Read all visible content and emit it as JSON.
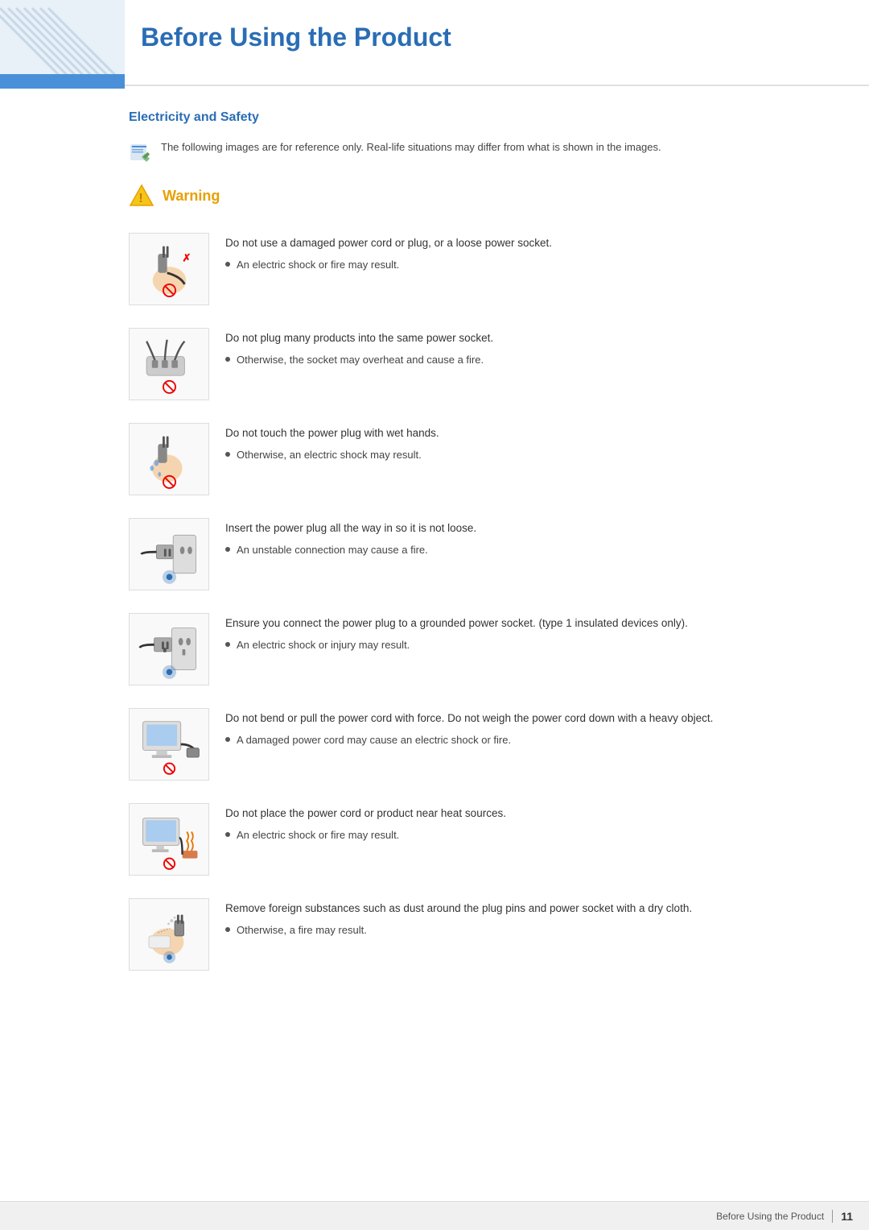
{
  "header": {
    "title": "Before Using the Product",
    "accent_color": "#4a90d9"
  },
  "page": {
    "number": "11",
    "footer_label": "Before Using the Product"
  },
  "section": {
    "title": "Electricity and Safety"
  },
  "note": {
    "text": "The following images are for reference only. Real-life situations may differ from what is shown in the images."
  },
  "warning": {
    "label": "Warning"
  },
  "items": [
    {
      "main": "Do not use a damaged power cord or plug, or a loose power socket.",
      "sub": "An electric shock or fire may result.",
      "icon_type": "plug-damaged"
    },
    {
      "main": "Do not plug many products into the same power socket.",
      "sub": "Otherwise, the socket may overheat and cause a fire.",
      "icon_type": "multi-plug"
    },
    {
      "main": "Do not touch the power plug with wet hands.",
      "sub": "Otherwise, an electric shock may result.",
      "icon_type": "wet-hands"
    },
    {
      "main": "Insert the power plug all the way in so it is not loose.",
      "sub": "An unstable connection may cause a fire.",
      "icon_type": "plug-insert"
    },
    {
      "main": "Ensure you connect the power plug to a grounded power socket. (type 1 insulated devices only).",
      "sub": "An electric shock or injury may result.",
      "icon_type": "grounded"
    },
    {
      "main": "Do not bend or pull the power cord with force. Do not weigh the power cord down with a heavy object.",
      "sub": "A damaged power cord may cause an electric shock or fire.",
      "icon_type": "cord-bend"
    },
    {
      "main": "Do not place the power cord or product near heat sources.",
      "sub": "An electric shock or fire may result.",
      "icon_type": "heat-source"
    },
    {
      "main": "Remove foreign substances such as dust around the plug pins and power socket with a dry cloth.",
      "sub": "Otherwise, a fire may result.",
      "icon_type": "clean-plug"
    }
  ]
}
